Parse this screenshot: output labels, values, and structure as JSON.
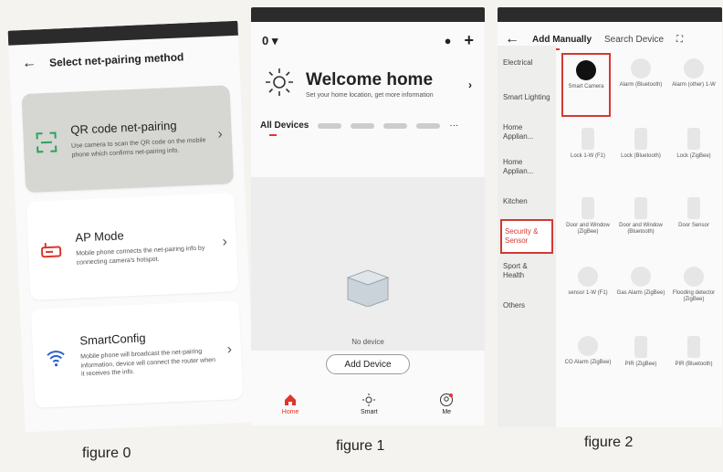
{
  "fig0": {
    "title": "Select net-pairing method",
    "methods": [
      {
        "title": "QR code net-pairing",
        "desc": "Use camera to scan the QR code on the mobile phone which confirms net-pairing info.",
        "icon": "qr-scan-icon"
      },
      {
        "title": "AP Mode",
        "desc": "Mobile phone connects the net-pairing info by connecting camera's hotspot.",
        "icon": "router-icon"
      },
      {
        "title": "SmartConfig",
        "desc": "Mobile phone will broadcast the net-pairing information, device will connect the router when it receives the info.",
        "icon": "wifi-icon"
      }
    ],
    "caption": "figure 0"
  },
  "fig1": {
    "home_selector": "0",
    "welcome_title": "Welcome home",
    "welcome_sub": "Set your home location, get more information",
    "all_devices": "All Devices",
    "no_device": "No device",
    "add_device": "Add Device",
    "tabs": [
      {
        "label": "Home",
        "icon": "home-icon"
      },
      {
        "label": "Smart",
        "icon": "sun-icon"
      },
      {
        "label": "Me",
        "icon": "profile-icon"
      }
    ],
    "caption": "figure 1"
  },
  "fig2": {
    "tab_add": "Add Manually",
    "tab_search": "Search Device",
    "categories": [
      "Electrical",
      "Smart Lighting",
      "Home Applian...",
      "Home Applian...",
      "Kitchen",
      "Security & Sensor",
      "Sport & Health",
      "Others"
    ],
    "devices": [
      "Smart Camera",
      "Alarm (Bluetooth)",
      "Alarm (other) 1-W",
      "Lock 1-W (F1)",
      "Lock (Bluetooth)",
      "Lock (ZigBee)",
      "Door and Window (ZigBee)",
      "Door and Window (Bluetooth)",
      "Door Sensor",
      "sensor 1-W (F1)",
      "Gas Alarm (ZigBee)",
      "Flooding detector (ZigBee)",
      "CO Alarm (ZigBee)",
      "PIR (ZigBee)",
      "PIR (Bluetooth)"
    ],
    "caption": "figure 2"
  },
  "colors": {
    "accent": "#e0352b",
    "highlight_border": "#d13a33"
  }
}
